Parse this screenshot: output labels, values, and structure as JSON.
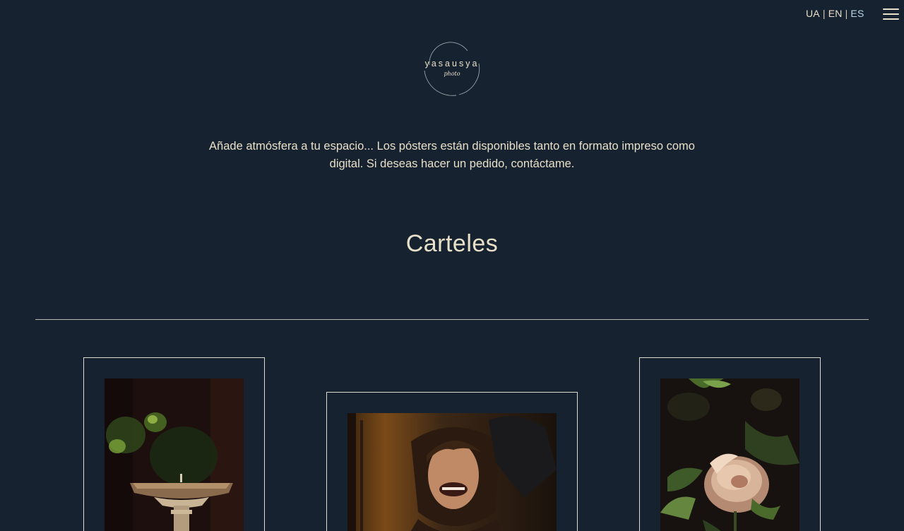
{
  "header": {
    "languages": [
      {
        "label": "UA"
      },
      {
        "label": "EN"
      },
      {
        "label": "ES",
        "active": true
      }
    ],
    "separator": "|",
    "menu_icon": "hamburger-menu-icon"
  },
  "logo": {
    "brand": "yasausya",
    "sub": "photo"
  },
  "intro": {
    "text": "Añade atmósfera a tu espacio... Los pósters están disponibles tanto en formato impreso como digital. Si deseas hacer un pedido, contáctame."
  },
  "main": {
    "title": "Carteles"
  },
  "posters": [
    {
      "subject": "fountain"
    },
    {
      "subject": "laughing-woman"
    },
    {
      "subject": "rose"
    }
  ],
  "colors": {
    "background": "#172230",
    "text": "#e8e0c8",
    "active_language": "#bcd7e6",
    "frame_border": "#dfdbcf"
  }
}
